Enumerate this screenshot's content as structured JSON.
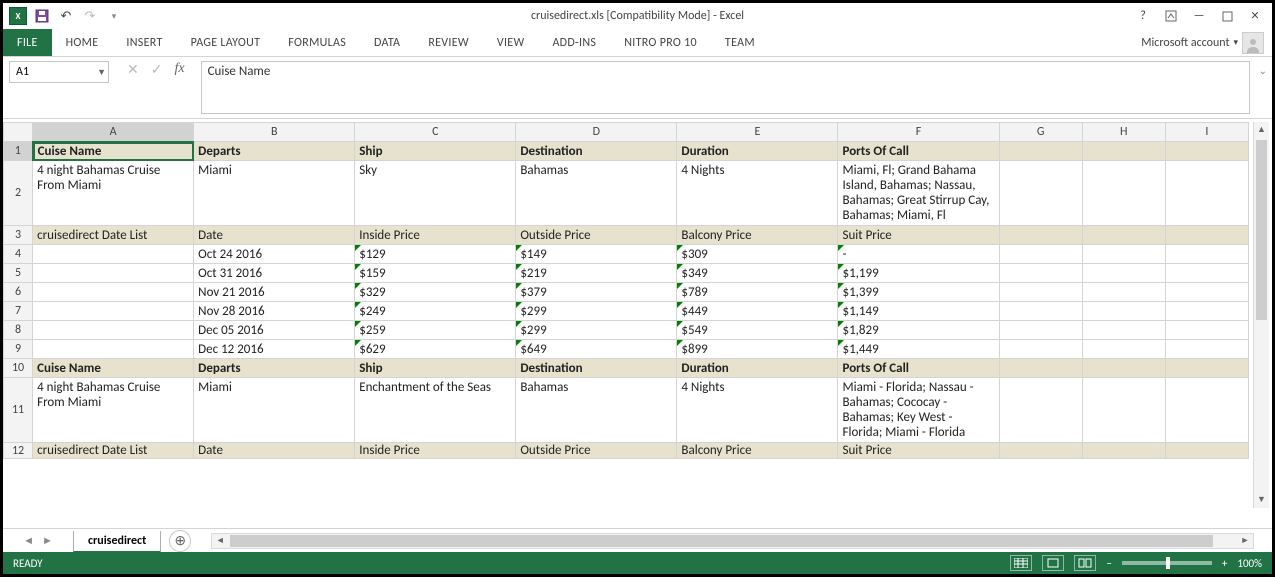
{
  "title": "cruisedirect.xls  [Compatibility Mode] - Excel",
  "account_label": "Microsoft account",
  "tabs": [
    "FILE",
    "HOME",
    "INSERT",
    "PAGE LAYOUT",
    "FORMULAS",
    "DATA",
    "REVIEW",
    "VIEW",
    "ADD-INS",
    "NITRO PRO 10",
    "TEAM"
  ],
  "namebox": "A1",
  "formula": "Cuise Name",
  "columns": [
    "A",
    "B",
    "C",
    "D",
    "E",
    "F",
    "G",
    "H",
    "I"
  ],
  "rows": [
    {
      "n": "1",
      "tall": false,
      "band": true,
      "sel": true,
      "cells": [
        "Cuise Name",
        "Departs",
        "Ship",
        "Destination",
        "Duration",
        "Ports Of Call",
        "",
        "",
        ""
      ]
    },
    {
      "n": "2",
      "tall": true,
      "band": false,
      "cells": [
        "4 night Bahamas Cruise From Miami",
        "Miami",
        "Sky",
        "Bahamas",
        "4 Nights",
        "Miami, Fl; Grand Bahama Island, Bahamas; Nassau, Bahamas; Great Stirrup Cay, Bahamas; Miami, Fl",
        "",
        "",
        ""
      ]
    },
    {
      "n": "3",
      "tall": false,
      "band": true,
      "boldOverride": false,
      "cells": [
        "cruisedirect Date List",
        "Date",
        "Inside Price",
        "Outside Price",
        "Balcony Price",
        "Suit Price",
        "",
        "",
        ""
      ]
    },
    {
      "n": "4",
      "tall": false,
      "band": false,
      "flags": [
        2,
        3,
        4,
        5
      ],
      "cells": [
        "",
        "Oct 24 2016",
        "$129",
        "$149",
        "$309",
        "-",
        "",
        "",
        ""
      ]
    },
    {
      "n": "5",
      "tall": false,
      "band": false,
      "flags": [
        2,
        3,
        4,
        5
      ],
      "cells": [
        "",
        "Oct 31 2016",
        "$159",
        "$219",
        "$349",
        "$1,199",
        "",
        "",
        ""
      ]
    },
    {
      "n": "6",
      "tall": false,
      "band": false,
      "flags": [
        2,
        3,
        4,
        5
      ],
      "cells": [
        "",
        "Nov 21 2016",
        "$329",
        "$379",
        "$789",
        "$1,399",
        "",
        "",
        ""
      ]
    },
    {
      "n": "7",
      "tall": false,
      "band": false,
      "flags": [
        2,
        3,
        4,
        5
      ],
      "cells": [
        "",
        "Nov 28 2016",
        "$249",
        "$299",
        "$449",
        "$1,149",
        "",
        "",
        ""
      ]
    },
    {
      "n": "8",
      "tall": false,
      "band": false,
      "flags": [
        2,
        3,
        4,
        5
      ],
      "cells": [
        "",
        "Dec 05 2016",
        "$259",
        "$299",
        "$549",
        "$1,829",
        "",
        "",
        ""
      ]
    },
    {
      "n": "9",
      "tall": false,
      "band": false,
      "flags": [
        2,
        3,
        4,
        5
      ],
      "cells": [
        "",
        "Dec 12 2016",
        "$629",
        "$649",
        "$899",
        "$1,449",
        "",
        "",
        ""
      ]
    },
    {
      "n": "10",
      "tall": false,
      "band": true,
      "cells": [
        "Cuise Name",
        "Departs",
        "Ship",
        "Destination",
        "Duration",
        "Ports Of Call",
        "",
        "",
        ""
      ]
    },
    {
      "n": "11",
      "tall": true,
      "band": false,
      "cells": [
        "4 night Bahamas Cruise From Miami",
        "Miami",
        "Enchantment of the Seas",
        "Bahamas",
        "4 Nights",
        "Miami -  Florida; Nassau - Bahamas; Cococay - Bahamas; Key West - Florida; Miami -  Florida",
        "",
        "",
        ""
      ]
    },
    {
      "n": "12",
      "tall": false,
      "band": true,
      "boldOverride": false,
      "clip": true,
      "cells": [
        "cruisedirect Date List",
        "Date",
        "Inside Price",
        "Outside Price",
        "Balcony Price",
        "Suit Price",
        "",
        "",
        ""
      ]
    }
  ],
  "sheet_tab": "cruisedirect",
  "status": "READY",
  "zoom": "100%"
}
